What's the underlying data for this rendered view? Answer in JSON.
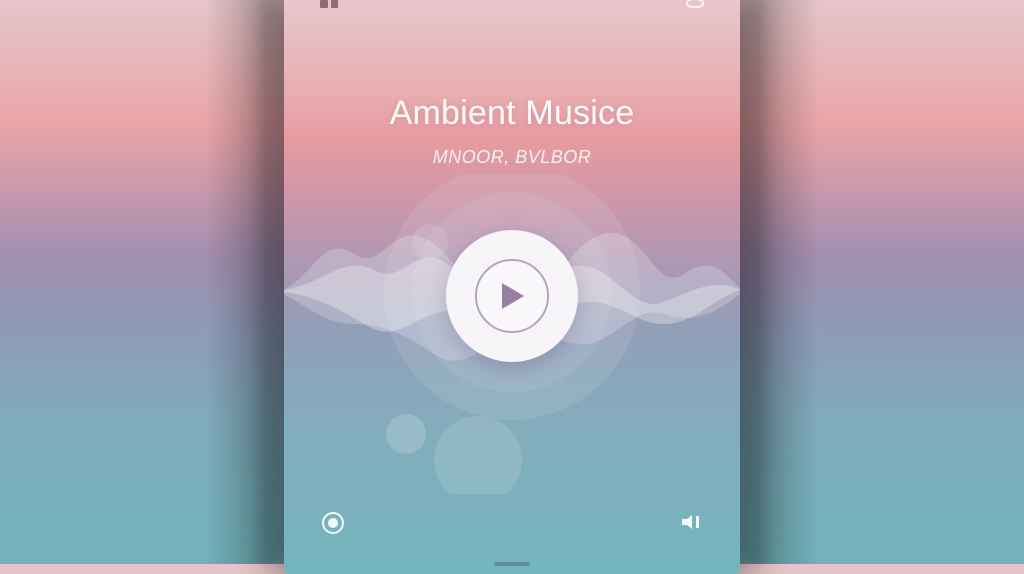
{
  "player": {
    "title": "Ambient Musice",
    "subtitle": "MNOOR, BVLBOR"
  },
  "icons": {
    "status_left": "grid-icon",
    "status_right": "settings-icon",
    "play": "play-icon",
    "left_control": "record-icon",
    "right_control": "volume-icon"
  },
  "colors": {
    "accent": "#9a7fa5",
    "play_button": "#f7f5f7",
    "gradient_top": "#e8c8cd",
    "gradient_mid": "#a898b5",
    "gradient_bottom": "#74b6bd"
  }
}
